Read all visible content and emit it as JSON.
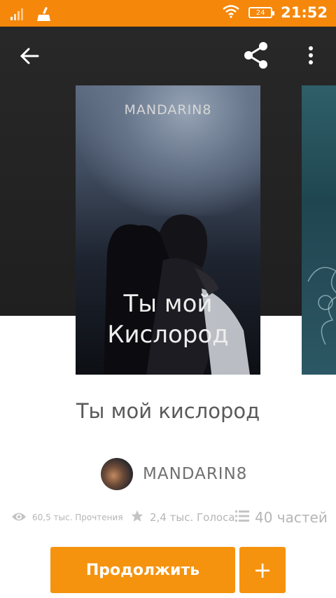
{
  "status_bar": {
    "time": "21:52",
    "battery": "24",
    "icons": [
      "signal-icon",
      "cleaner-icon",
      "wifi-icon",
      "battery-icon"
    ]
  },
  "toolbar": {
    "icons": [
      "back-arrow-icon",
      "share-icon",
      "more-vert-icon"
    ]
  },
  "cover": {
    "author": "MANDARIN8",
    "title_line1": "Ты мой",
    "title_line2": "Кислород"
  },
  "book": {
    "title": "Ты мой кислород",
    "author": "MANDARIN8"
  },
  "stats": {
    "reads": "60,5 тыс. Прочтения",
    "votes": "2,4 тыс. Голоса",
    "parts": "40 частей"
  },
  "actions": {
    "continue_label": "Продолжить",
    "add_label": "+"
  },
  "colors": {
    "accent": "#f5930f",
    "status_bar": "#f5870a",
    "hero_bg": "#262626"
  }
}
